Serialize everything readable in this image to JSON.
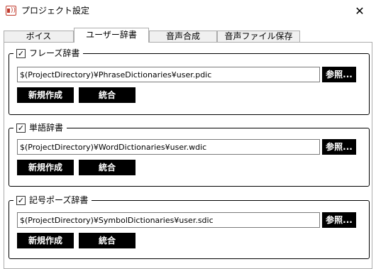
{
  "window": {
    "title": "プロジェクト設定",
    "close_glyph": "✕",
    "app_icon_glyph": "))"
  },
  "tabs": [
    {
      "label": "ボイス",
      "active": false
    },
    {
      "label": "ユーザー辞書",
      "active": true
    },
    {
      "label": "音声合成",
      "active": false
    },
    {
      "label": "音声ファイル保存",
      "active": false
    }
  ],
  "dictionaries": {
    "phrase": {
      "label": "フレーズ辞書",
      "checked": true,
      "path": "$(ProjectDirectory)¥PhraseDictionaries¥user.pdic",
      "browse_label": "参照...",
      "new_label": "新規作成",
      "merge_label": "統合"
    },
    "word": {
      "label": "単語辞書",
      "checked": true,
      "path": "$(ProjectDirectory)¥WordDictionaries¥user.wdic",
      "browse_label": "参照...",
      "new_label": "新規作成",
      "merge_label": "統合"
    },
    "symbol": {
      "label": "記号ポーズ辞書",
      "checked": true,
      "path": "$(ProjectDirectory)¥SymbolDictionaries¥user.sdic",
      "browse_label": "参照...",
      "new_label": "新規作成",
      "merge_label": "統合"
    }
  },
  "colors": {
    "button_bg": "#000000",
    "button_fg": "#ffffff",
    "icon_accent": "#c0392b"
  },
  "icons": {
    "app": "speaker-icon",
    "check": "checkmark-icon",
    "close": "close-icon"
  }
}
